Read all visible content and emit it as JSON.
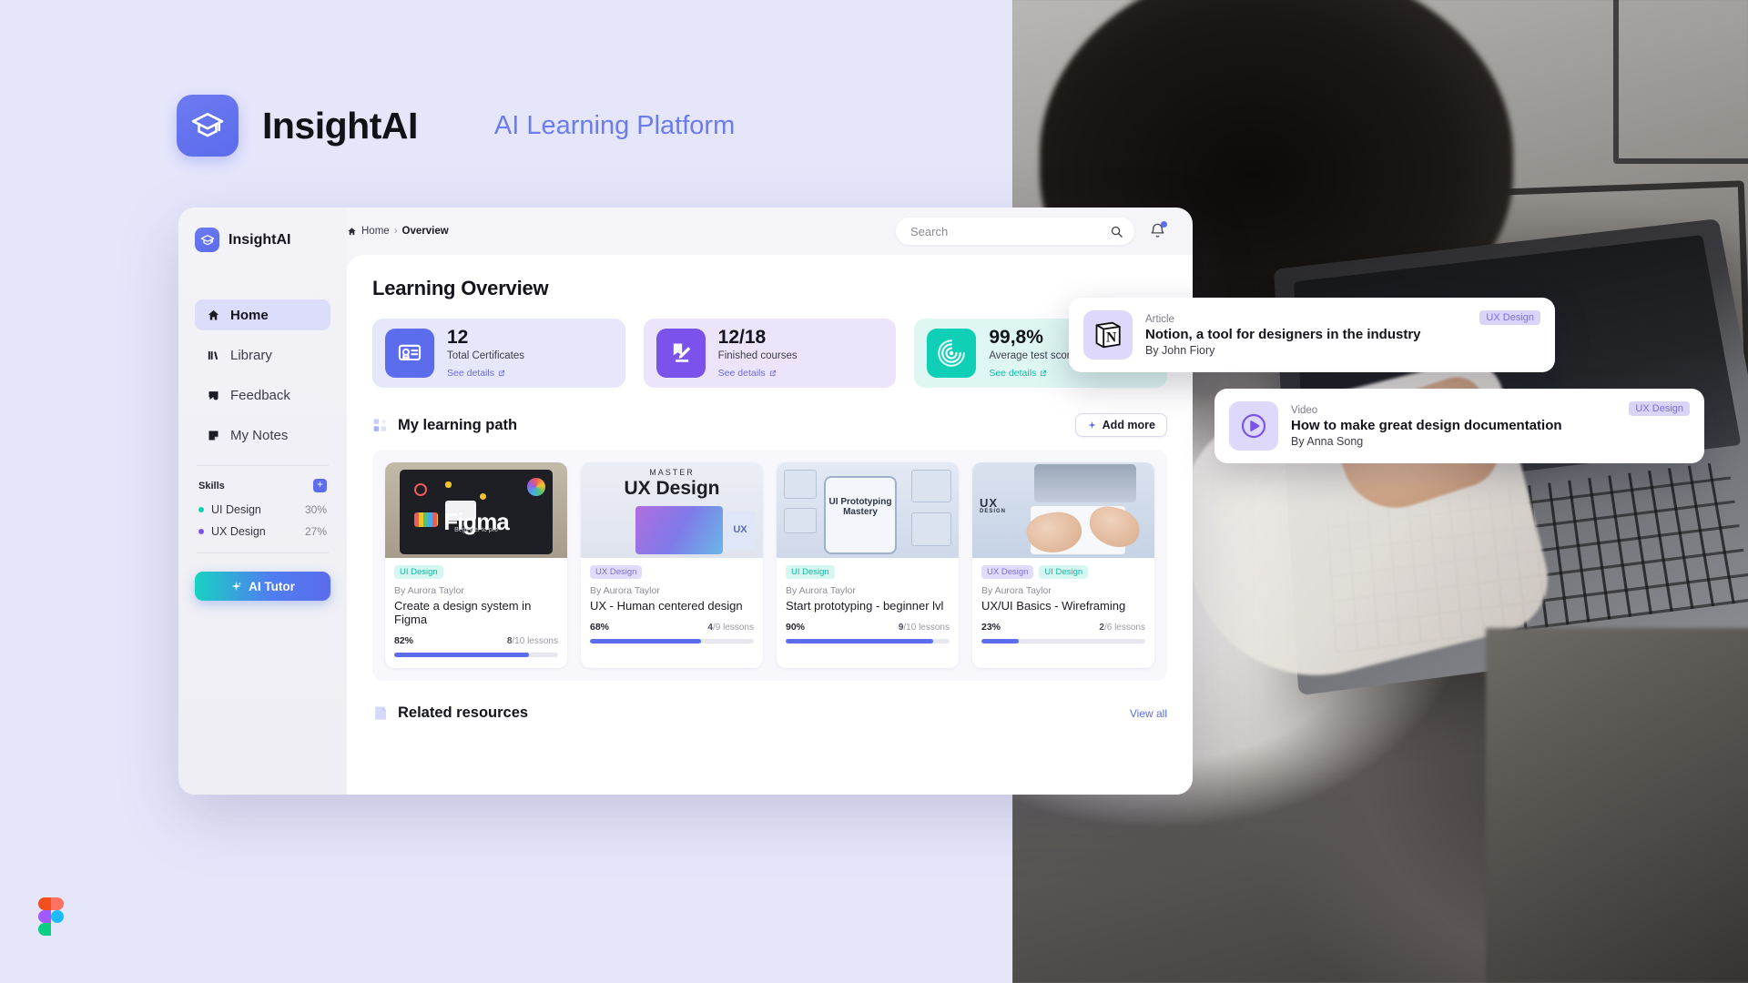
{
  "hero": {
    "brand": "InsightAI",
    "subtitle": "AI Learning Platform",
    "logo_icon": "graduation-cap-icon"
  },
  "sidebar": {
    "brand": "InsightAI",
    "nav": [
      {
        "label": "Home",
        "icon": "home-icon",
        "active": true
      },
      {
        "label": "Library",
        "icon": "library-icon",
        "active": false
      },
      {
        "label": "Feedback",
        "icon": "feedback-icon",
        "active": false
      },
      {
        "label": "My Notes",
        "icon": "note-icon",
        "active": false
      }
    ],
    "skills_title": "Skills",
    "skills_add_label": "+",
    "skills": [
      {
        "name": "UI Design",
        "percent": "30%",
        "color": "#16cfb4"
      },
      {
        "name": "UX Design",
        "percent": "27%",
        "color": "#7b52ec"
      }
    ],
    "ai_tutor_label": "AI Tutor"
  },
  "topbar": {
    "breadcrumb_home": "Home",
    "breadcrumb_sep": "›",
    "breadcrumb_current": "Overview",
    "search_placeholder": "Search",
    "search_value": "",
    "search_icon": "search-icon",
    "bell_icon": "bell-icon"
  },
  "overview": {
    "title": "Learning  Overview",
    "stats": [
      {
        "value": "12",
        "label": "Total Certificates",
        "link": "See details",
        "icon": "certificate-icon",
        "accent": "#5b6ced"
      },
      {
        "value": "12/18",
        "label": "Finished courses",
        "link": "See details",
        "icon": "edit-book-icon",
        "accent": "#7b52ec"
      },
      {
        "value": "99,8%",
        "label": "Average test score",
        "link": "See details",
        "icon": "target-icon",
        "accent": "#0fcfb6"
      }
    ]
  },
  "learning_path": {
    "title": "My learning path",
    "icon": "sparkle-grid-icon",
    "add_more_label": "Add more",
    "courses": [
      {
        "tags": [
          "UI Design"
        ],
        "tag_types": [
          "ui"
        ],
        "author": "By Aurora Taylor",
        "title": "Create a design system in Figma",
        "percent": "82%",
        "progress": 82,
        "lessons_done": "8",
        "lessons_total": "/10 lessons",
        "thumb_text": "Figma",
        "thumb_sub": "Beginner to pro"
      },
      {
        "tags": [
          "UX Design"
        ],
        "tag_types": [
          "ux"
        ],
        "author": "By Aurora Taylor",
        "title": "UX - Human centered design",
        "percent": "68%",
        "progress": 68,
        "lessons_done": "4",
        "lessons_total": "/9 lessons",
        "thumb_text": "UX Design",
        "thumb_sub": "MASTER"
      },
      {
        "tags": [
          "UI Design"
        ],
        "tag_types": [
          "ui"
        ],
        "author": "By Aurora Taylor",
        "title": "Start prototyping - beginner lvl",
        "percent": "90%",
        "progress": 90,
        "lessons_done": "9",
        "lessons_total": "/10 lessons",
        "thumb_text": "UI Prototyping Mastery",
        "thumb_sub": ""
      },
      {
        "tags": [
          "UX Design",
          "UI Design"
        ],
        "tag_types": [
          "ux",
          "ui"
        ],
        "author": "By Aurora Taylor",
        "title": "UX/UI Basics - Wireframing",
        "percent": "23%",
        "progress": 23,
        "lessons_done": "2",
        "lessons_total": "/6 lessons",
        "thumb_text": "UX",
        "thumb_sub": "DESIGN"
      }
    ]
  },
  "related": {
    "title": "Related resources",
    "icon": "document-sparkle-icon",
    "view_all_label": "View all"
  },
  "floating_cards": [
    {
      "kind": "Article",
      "title": "Notion, a tool for designers in the industry",
      "author": "By John Fiory",
      "tag": "UX Design",
      "icon": "notion-icon"
    },
    {
      "kind": "Video",
      "title": "How to make great design documentation",
      "author": "By Anna Song",
      "tag": "UX Design",
      "icon": "play-circle-icon"
    }
  ],
  "watermark": {
    "name": "figma-logo"
  }
}
